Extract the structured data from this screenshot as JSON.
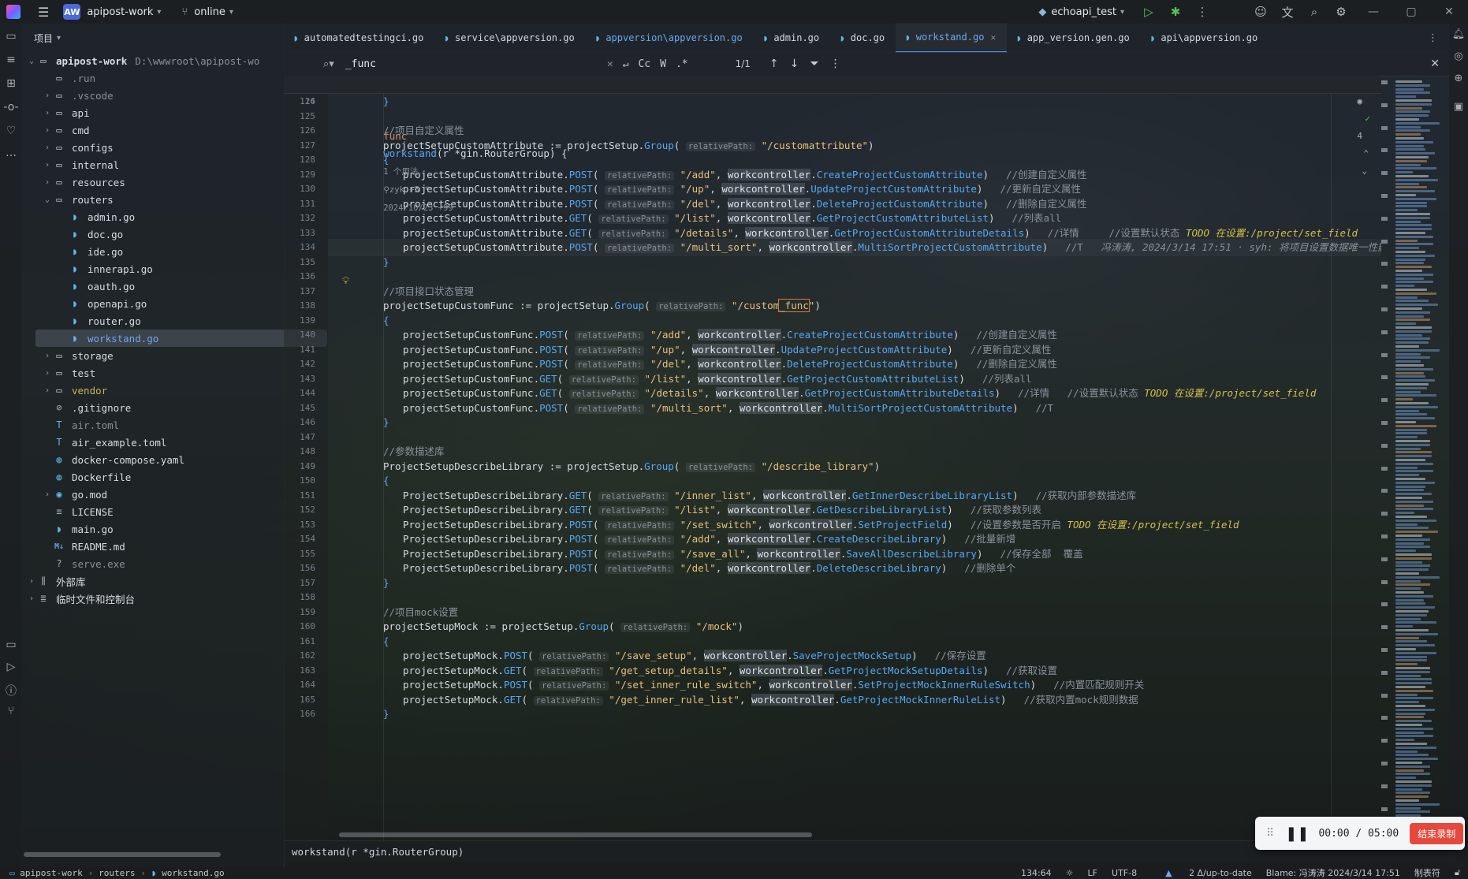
{
  "titlebar": {
    "project_badge": "AW",
    "project_name": "apipost-work",
    "branch": "online",
    "run_config": "echoapi_test"
  },
  "sidebar": {
    "header": "项目",
    "items": [
      {
        "label": "apipost-work",
        "extra": "D:\\wwwroot\\apipost-wo",
        "kind": "root"
      },
      {
        "label": ".run",
        "kind": "folder-muted"
      },
      {
        "label": ".vscode",
        "kind": "folder-muted"
      },
      {
        "label": "api",
        "kind": "folder"
      },
      {
        "label": "cmd",
        "kind": "folder"
      },
      {
        "label": "configs",
        "kind": "folder"
      },
      {
        "label": "internal",
        "kind": "folder"
      },
      {
        "label": "resources",
        "kind": "folder"
      },
      {
        "label": "routers",
        "kind": "folder-open"
      },
      {
        "label": "admin.go",
        "kind": "go"
      },
      {
        "label": "doc.go",
        "kind": "go"
      },
      {
        "label": "ide.go",
        "kind": "go"
      },
      {
        "label": "innerapi.go",
        "kind": "go"
      },
      {
        "label": "oauth.go",
        "kind": "go"
      },
      {
        "label": "openapi.go",
        "kind": "go"
      },
      {
        "label": "router.go",
        "kind": "go"
      },
      {
        "label": "workstand.go",
        "kind": "go-selected"
      },
      {
        "label": "storage",
        "kind": "folder"
      },
      {
        "label": "test",
        "kind": "folder"
      },
      {
        "label": "vendor",
        "kind": "folder-vendor"
      },
      {
        "label": ".gitignore",
        "kind": "file"
      },
      {
        "label": "air.toml",
        "kind": "file-muted"
      },
      {
        "label": "air_example.toml",
        "kind": "file"
      },
      {
        "label": "docker-compose.yaml",
        "kind": "file"
      },
      {
        "label": "Dockerfile",
        "kind": "file"
      },
      {
        "label": "go.mod",
        "kind": "gomod"
      },
      {
        "label": "LICENSE",
        "kind": "file"
      },
      {
        "label": "main.go",
        "kind": "go"
      },
      {
        "label": "README.md",
        "kind": "md"
      },
      {
        "label": "serve.exe",
        "kind": "file-muted"
      },
      {
        "label": "外部库",
        "kind": "lib"
      },
      {
        "label": "临时文件和控制台",
        "kind": "scratch"
      }
    ]
  },
  "tabs": [
    {
      "label": "automatedtestingci.go"
    },
    {
      "label": "service\\appversion.go"
    },
    {
      "label": "appversion\\appversion.go"
    },
    {
      "label": "admin.go"
    },
    {
      "label": "doc.go"
    },
    {
      "label": "workstand.go"
    },
    {
      "label": "app_version.gen.go"
    },
    {
      "label": "api\\appversion.go"
    }
  ],
  "search": {
    "value": "_func",
    "count": "1/1",
    "case_label": "Cc",
    "word_label": "W",
    "regex_label": ".*"
  },
  "sticky": {
    "line_no": "16",
    "keyword": "func",
    "name": "workstand",
    "params": "(r *gin.RouterGroup) {",
    "usages": "1 个用法",
    "authors": "zyk +5 *",
    "date": "2024/10/23 +99",
    "inspections": "4"
  },
  "code_lines": [
    {
      "n": "124",
      "text": "}"
    },
    {
      "n": "125",
      "text": ""
    },
    {
      "n": "126",
      "text": "//项目自定义属性"
    },
    {
      "n": "127",
      "text": "projectSetupCustomAttribute := projectSetup.Group( relativePath: \"/customattribute\")"
    },
    {
      "n": "128",
      "text": "{"
    },
    {
      "n": "129",
      "text": "projectSetupCustomAttribute.POST( relativePath: \"/add\", workcontroller.CreateProjectCustomAttribute)",
      "comment": "//创建自定义属性"
    },
    {
      "n": "130",
      "text": "projectSetupCustomAttribute.POST( relativePath: \"/up\", workcontroller.UpdateProjectCustomAttribute)",
      "comment": "//更新自定义属性"
    },
    {
      "n": "131",
      "text": "projectSetupCustomAttribute.POST( relativePath: \"/del\", workcontroller.DeleteProjectCustomAttribute)",
      "comment": "//删除自定义属性"
    },
    {
      "n": "132",
      "text": "projectSetupCustomAttribute.GET( relativePath: \"/list\", workcontroller.GetProjectCustomAttributeList)",
      "comment": "//列表all"
    },
    {
      "n": "133",
      "text": "projectSetupCustomAttribute.GET( relativePath: \"/details\", workcontroller.GetProjectCustomAttributeDetails)",
      "comment": "//详情     //设置默认状态",
      "todo": "TODO 在设置:/project/set_field"
    },
    {
      "n": "134",
      "text": "projectSetupCustomAttribute.POST( relativePath: \"/multi_sort\", workcontroller.MultiSortProjectCustomAttribute)",
      "comment": "//T",
      "blame": "冯涛涛, 2024/3/14 17:51 · syh: 将项目设置数据唯一性影"
    },
    {
      "n": "135",
      "text": "}"
    },
    {
      "n": "136",
      "text": ""
    },
    {
      "n": "137",
      "text": "//项目接口状态管理"
    },
    {
      "n": "138",
      "text": "projectSetupCustomFunc := projectSetup.Group( relativePath: \"/custom_func\")"
    },
    {
      "n": "139",
      "text": "{"
    },
    {
      "n": "140",
      "text": "projectSetupCustomFunc.POST( relativePath: \"/add\", workcontroller.CreateProjectCustomAttribute)",
      "comment": "//创建自定义属性"
    },
    {
      "n": "141",
      "text": "projectSetupCustomFunc.POST( relativePath: \"/up\", workcontroller.UpdateProjectCustomAttribute)",
      "comment": "//更新自定义属性"
    },
    {
      "n": "142",
      "text": "projectSetupCustomFunc.POST( relativePath: \"/del\", workcontroller.DeleteProjectCustomAttribute)",
      "comment": "//删除自定义属性"
    },
    {
      "n": "143",
      "text": "projectSetupCustomFunc.GET( relativePath: \"/list\", workcontroller.GetProjectCustomAttributeList)",
      "comment": "//列表all"
    },
    {
      "n": "144",
      "text": "projectSetupCustomFunc.GET( relativePath: \"/details\", workcontroller.GetProjectCustomAttributeDetails)",
      "comment": "//详情   //设置默认状态",
      "todo": "TODO 在设置:/project/set_field"
    },
    {
      "n": "145",
      "text": "projectSetupCustomFunc.POST( relativePath: \"/multi_sort\", workcontroller.MultiSortProjectCustomAttribute)",
      "comment": "//T"
    },
    {
      "n": "146",
      "text": "}"
    },
    {
      "n": "147",
      "text": ""
    },
    {
      "n": "148",
      "text": "//参数描述库"
    },
    {
      "n": "149",
      "text": "ProjectSetupDescribeLibrary := projectSetup.Group( relativePath: \"/describe_library\")"
    },
    {
      "n": "150",
      "text": "{"
    },
    {
      "n": "151",
      "text": "ProjectSetupDescribeLibrary.GET( relativePath: \"/inner_list\", workcontroller.GetInnerDescribeLibraryList)",
      "comment": "//获取内部参数描述库"
    },
    {
      "n": "152",
      "text": "ProjectSetupDescribeLibrary.GET( relativePath: \"/list\", workcontroller.GetDescribeLibraryList)",
      "comment": "//获取参数列表"
    },
    {
      "n": "153",
      "text": "ProjectSetupDescribeLibrary.POST( relativePath: \"/set_switch\", workcontroller.SetProjectField)",
      "comment": "//设置参数是否开启",
      "todo": "TODO 在设置:/project/set_field"
    },
    {
      "n": "154",
      "text": "ProjectSetupDescribeLibrary.POST( relativePath: \"/add\", workcontroller.CreateDescribeLibrary)",
      "comment": "//批量新增"
    },
    {
      "n": "155",
      "text": "ProjectSetupDescribeLibrary.POST( relativePath: \"/save_all\", workcontroller.SaveAllDescribeLibrary)",
      "comment": "//保存全部  覆盖"
    },
    {
      "n": "156",
      "text": "ProjectSetupDescribeLibrary.POST( relativePath: \"/del\", workcontroller.DeleteDescribeLibrary)",
      "comment": "//删除单个"
    },
    {
      "n": "157",
      "text": "}"
    },
    {
      "n": "158",
      "text": ""
    },
    {
      "n": "159",
      "text": "//项目mock设置"
    },
    {
      "n": "160",
      "text": "projectSetupMock := projectSetup.Group( relativePath: \"/mock\")"
    },
    {
      "n": "161",
      "text": "{"
    },
    {
      "n": "162",
      "text": "projectSetupMock.POST( relativePath: \"/save_setup\", workcontroller.SaveProjectMockSetup)",
      "comment": "//保存设置"
    },
    {
      "n": "163",
      "text": "projectSetupMock.GET( relativePath: \"/get_setup_details\", workcontroller.GetProjectMockSetupDetails)",
      "comment": "//获取设置"
    },
    {
      "n": "164",
      "text": "projectSetupMock.POST( relativePath: \"/set_inner_rule_switch\", workcontroller.SetProjectMockInnerRuleSwitch)",
      "comment": "//内置匹配规则开关"
    },
    {
      "n": "165",
      "text": "projectSetupMock.GET( relativePath: \"/get_inner_rule_list\", workcontroller.GetProjectMockInnerRuleList)",
      "comment": "//获取内置mock规则数据"
    },
    {
      "n": "166",
      "text": "}"
    }
  ],
  "editor_breadcrumb": "workstand(r *gin.RouterGroup)",
  "status": {
    "crumbs": [
      "apipost-work",
      "routers",
      "workstand.go"
    ],
    "position": "134:64",
    "line_sep": "LF",
    "encoding": "UTF-8",
    "vcs": "2 Δ/up-to-date",
    "blame": "Blame: 冯涛涛 2024/3/14 17:51",
    "indent": "制表符"
  },
  "recorder": {
    "time": "00:00 / 05:00",
    "stop_label": "结束录制"
  }
}
